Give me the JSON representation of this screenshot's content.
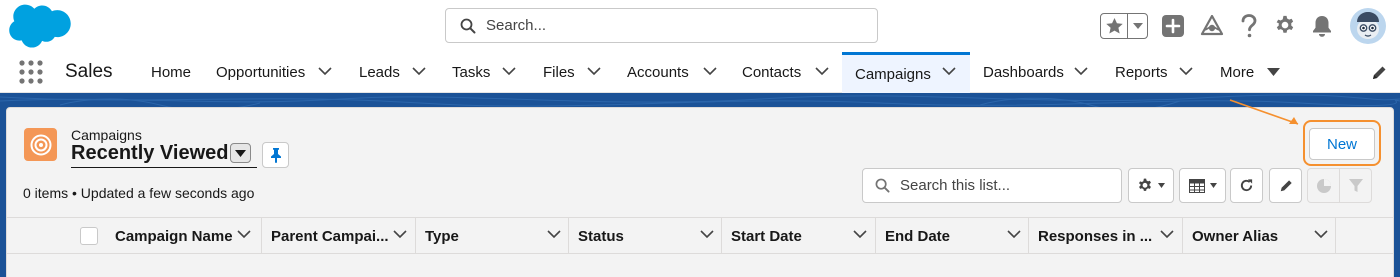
{
  "header": {
    "search_placeholder": "Search...",
    "icons": [
      "salesforce-cloud-logo",
      "star-icon",
      "chevron-down-icon",
      "plus-icon",
      "trailhead-icon",
      "help-icon",
      "gear-icon",
      "bell-icon",
      "avatar"
    ]
  },
  "nav": {
    "app_name": "Sales",
    "items": [
      {
        "label": "Home"
      },
      {
        "label": "Opportunities"
      },
      {
        "label": "Leads"
      },
      {
        "label": "Tasks"
      },
      {
        "label": "Files"
      },
      {
        "label": "Accounts"
      },
      {
        "label": "Contacts"
      },
      {
        "label": "Campaigns"
      },
      {
        "label": "Dashboards"
      },
      {
        "label": "Reports"
      },
      {
        "label": "More"
      }
    ],
    "active": "Campaigns"
  },
  "list": {
    "object_label": "Campaigns",
    "view_name": "Recently Viewed",
    "meta": "0 items • Updated a few seconds ago",
    "new_label": "New",
    "search_placeholder": "Search this list...",
    "columns": [
      {
        "label": "Campaign Name"
      },
      {
        "label": "Parent Campai..."
      },
      {
        "label": "Type"
      },
      {
        "label": "Status"
      },
      {
        "label": "Start Date"
      },
      {
        "label": "End Date"
      },
      {
        "label": "Responses in ..."
      },
      {
        "label": "Owner Alias"
      }
    ]
  },
  "colors": {
    "brand_blue": "#0176d3",
    "band_blue": "#1b5297",
    "campaign_icon": "#f49756",
    "highlight_orange": "#f5902f"
  }
}
